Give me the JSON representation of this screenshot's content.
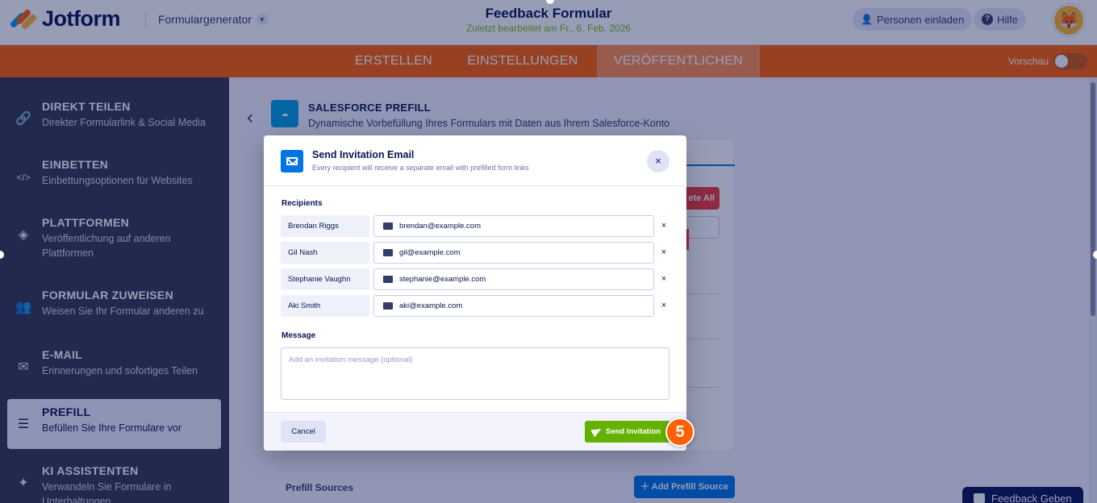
{
  "header": {
    "logo_text": "Jotform",
    "generator_label": "Formulargenerator",
    "form_title": "Feedback Formular",
    "form_subtitle": "Zuletzt bearbeitet am Fr., 6. Feb. 2026",
    "invite_label": "Personen einladen",
    "help_label": "Hilfe",
    "help_icon": "?"
  },
  "nav": {
    "tabs": [
      {
        "label": "ERSTELLEN"
      },
      {
        "label": "EINSTELLUNGEN"
      },
      {
        "label": "VERÖFFENTLICHEN"
      }
    ],
    "active_tab": "VERÖFFENTLICHEN",
    "preview_label": "Vorschau",
    "preview_on": false
  },
  "sidebar": {
    "items": [
      {
        "title": "DIREKT TEILEN",
        "desc": "Direkter Formularlink & Social Media",
        "icon": "link-icon"
      },
      {
        "title": "EINBETTEN",
        "desc": "Einbettungsoptionen für Websites",
        "icon": "code-icon"
      },
      {
        "title": "PLATTFORMEN",
        "desc": "Veröffentlichung auf anderen Plattformen",
        "icon": "layers-icon"
      },
      {
        "title": "FORMULAR ZUWEISEN",
        "desc": "Weisen Sie Ihr Formular anderen zu",
        "icon": "users-icon"
      },
      {
        "title": "E-MAIL",
        "desc": "Erinnerungen und sofortiges Teilen",
        "icon": "envelope-icon"
      },
      {
        "title": "PREFILL",
        "desc": "Befüllen Sie Ihre Formulare vor",
        "icon": "database-icon"
      },
      {
        "title": "KI ASSISTENTEN",
        "desc": "Verwandeln Sie Formulare in Unterhaltungen",
        "icon": "sparkle-icon"
      }
    ],
    "active_item": "PREFILL"
  },
  "main": {
    "integration_title": "SALESFORCE PREFILL",
    "integration_desc": "Dynamische Vorbefüllung Ihres Formulars mit Daten aus Ihrem Salesforce-Konto",
    "delete_all_label": "ete All",
    "prefill_sources_label": "Prefill Sources",
    "add_source_label": "Add Prefill Source",
    "feedback_label": "Feedback Geben"
  },
  "modal": {
    "title": "Send Invitation Email",
    "subtitle": "Every recipient will receive a separate email with prefilled form links",
    "recipients_label": "Recipients",
    "recipients": [
      {
        "name": "Brendan Riggs",
        "email": "brendan@example.com"
      },
      {
        "name": "Gil Nash",
        "email": "gil@example.com"
      },
      {
        "name": "Stephanie Vaughn",
        "email": "stephanie@example.com"
      },
      {
        "name": "Aki Smith",
        "email": "aki@example.com"
      }
    ],
    "remove_symbol": "×",
    "close_symbol": "×",
    "message_label": "Message",
    "message_placeholder": "Add an invitation message (optional)",
    "cancel_label": "Cancel",
    "send_label": "Send Invitation"
  },
  "step_badge": "5",
  "colors": {
    "brand_orange": "#ff6100",
    "primary_blue": "#0075e3",
    "send_green": "#64b200",
    "sidebar_bg": "#33384f"
  }
}
